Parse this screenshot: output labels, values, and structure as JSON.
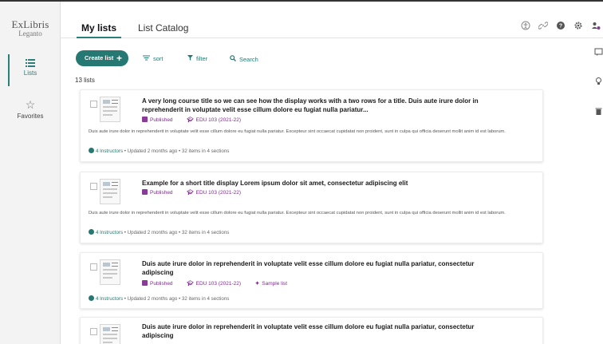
{
  "logo": {
    "line1": "ExLibris",
    "line2": "Leganto"
  },
  "sidebar": {
    "items": [
      {
        "label": "Lists"
      },
      {
        "label": "Favorites"
      }
    ]
  },
  "tabs": [
    {
      "label": "My lists",
      "active": true
    },
    {
      "label": "List Catalog",
      "active": false
    }
  ],
  "toolbar": {
    "create_label": "Create list",
    "create_icon": "+",
    "sort_label": "sort",
    "filter_label": "filter",
    "search_label": "Search"
  },
  "list_count": "13 lists",
  "status_text": "Published",
  "course_text": "EDU 103 (2021-22)",
  "sample_text": "Sample list",
  "description_text": "Duis aute irure dolor in reprehenderit in voluptate velit esse cillum dolore eu fugiat nulla pariatur. Excepteur sint occaecat cupidatat non proident, sunt in culpa qui officia deserunt mollit anim id est laborum.",
  "instructors_text": "4 Instructors",
  "footer_rest": "• Updated 2 months ago • 32 items in 4 sections",
  "cards": [
    {
      "title": "A very long course title so we can see how the display works with a two rows for a title. Duis aute irure dolor in reprehenderit in voluptate velit esse cillum dolore eu fugiat nulla pariatur..."
    },
    {
      "title": "Example for a short title display Lorem ipsum dolor sit amet, consectetur adipiscing elit"
    },
    {
      "title": "Duis aute irure dolor in reprehenderit in voluptate velit esse cillum dolore eu fugiat nulla pariatur, consectetur adipiscing"
    },
    {
      "title": "Duis aute irure dolor in reprehenderit in voluptate velit esse cillum dolore eu fugiat nulla pariatur, consectetur adipiscing"
    }
  ],
  "colors": {
    "accent": "#267872",
    "meta_purple": "#7b2a8a",
    "sidebar_bg": "#f3f3f3"
  },
  "icons": {
    "top_right": [
      "accessibility-icon",
      "link-icon",
      "help-icon",
      "settings-icon",
      "user-icon"
    ],
    "rail": [
      "comment-icon",
      "lightbulb-icon",
      "trash-icon"
    ]
  }
}
